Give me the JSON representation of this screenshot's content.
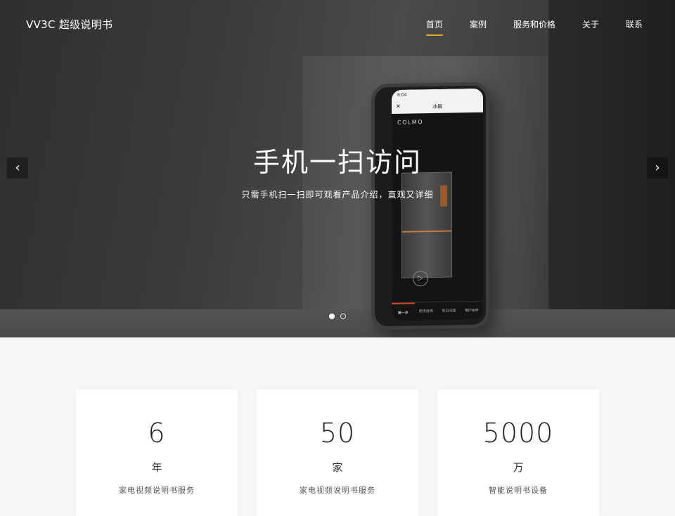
{
  "nav": {
    "brand": "VV3C 超级说明书",
    "items": [
      {
        "label": "首页"
      },
      {
        "label": "案例"
      },
      {
        "label": "服务和价格"
      },
      {
        "label": "关于"
      },
      {
        "label": "联系"
      }
    ],
    "active_index": 0,
    "accent_color": "#e0a52a"
  },
  "hero": {
    "title": "手机一扫访问",
    "subtitle": "只需手机扫一扫即可观看产品介绍，直观又详细",
    "prev_icon": "chevron-left-icon",
    "next_icon": "chevron-right-icon",
    "slide_count": 2,
    "active_slide": 1,
    "phone": {
      "time": "8:04",
      "screen_title": "冰箱",
      "brand": "COLMO",
      "tabs": [
        "第一步",
        "使用说明",
        "常见问题",
        "维护保养"
      ]
    }
  },
  "stats": [
    {
      "value": "6",
      "unit": "年",
      "desc": "家电视频说明书服务"
    },
    {
      "value": "50",
      "unit": "家",
      "desc": "家电视频说明书服务"
    },
    {
      "value": "5000",
      "unit": "万",
      "desc": "智能说明书设备"
    }
  ]
}
